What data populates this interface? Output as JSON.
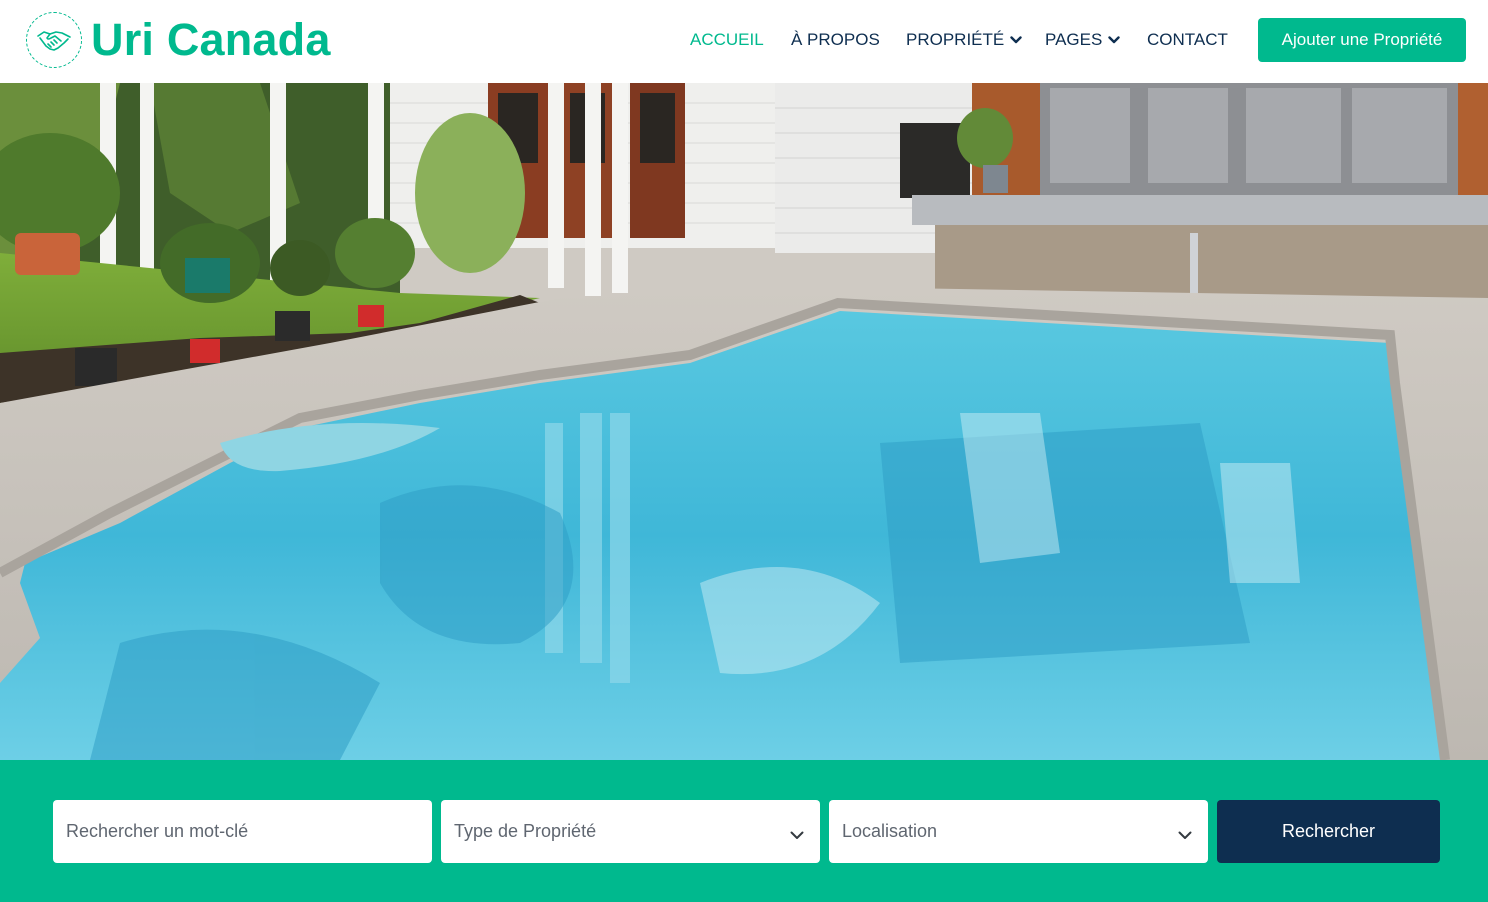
{
  "brand": {
    "name": "Uri Canada",
    "logo_icon": "handshake-icon",
    "accent_color": "#00b98e"
  },
  "nav": {
    "items": [
      {
        "label": "ACCUEIL",
        "active": true
      },
      {
        "label": "À PROPOS",
        "active": false
      },
      {
        "label": "PROPRIÉTÉ",
        "active": false,
        "has_dropdown": true
      },
      {
        "label": "PAGES",
        "active": false,
        "has_dropdown": true
      },
      {
        "label": "CONTACT",
        "active": false
      }
    ],
    "cta_label": "Ajouter une Propriété"
  },
  "hero": {
    "image_icon": "pool-house-photo"
  },
  "search": {
    "keyword_placeholder": "Rechercher un mot-clé",
    "property_type_value": "Type de Propriété",
    "location_value": "Localisation",
    "button_label": "Rechercher",
    "button_color": "#0e2e50"
  }
}
